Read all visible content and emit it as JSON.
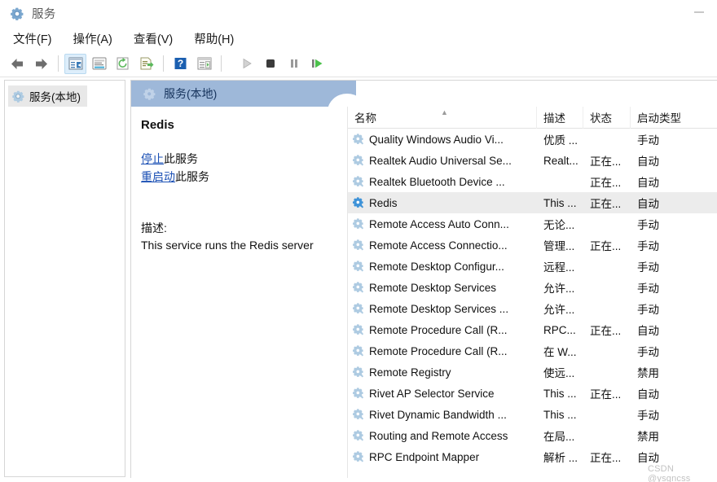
{
  "window": {
    "title": "服务",
    "title_icon": "services-gear-icon",
    "minimize_label": "最小化"
  },
  "menubar": {
    "items": [
      {
        "label": "文件(F)",
        "name": "menu-file"
      },
      {
        "label": "操作(A)",
        "name": "menu-action"
      },
      {
        "label": "查看(V)",
        "name": "menu-view"
      },
      {
        "label": "帮助(H)",
        "name": "menu-help"
      }
    ]
  },
  "toolbar": {
    "buttons": [
      {
        "name": "back-button",
        "icon": "arrow-left-icon",
        "enabled": true
      },
      {
        "name": "forward-button",
        "icon": "arrow-right-icon",
        "enabled": true
      },
      {
        "name": "show-hide-tree-button",
        "icon": "show-console-tree-icon",
        "enabled": true,
        "active": true
      },
      {
        "name": "properties-button",
        "icon": "properties-icon",
        "enabled": true
      },
      {
        "name": "refresh-button",
        "icon": "refresh-icon",
        "enabled": true
      },
      {
        "name": "export-list-button",
        "icon": "export-list-icon",
        "enabled": true
      },
      {
        "name": "help-button",
        "icon": "help-question-icon",
        "enabled": true
      },
      {
        "name": "show-action-pane-button",
        "icon": "action-pane-icon",
        "enabled": true
      },
      {
        "name": "start-service-button",
        "icon": "play-icon",
        "enabled": false
      },
      {
        "name": "stop-service-button",
        "icon": "stop-icon",
        "enabled": false
      },
      {
        "name": "pause-service-button",
        "icon": "pause-icon",
        "enabled": false
      },
      {
        "name": "restart-service-button",
        "icon": "restart-icon",
        "enabled": true
      }
    ]
  },
  "tree": {
    "root_label": "服务(本地)",
    "root_icon": "services-gear-icon"
  },
  "banner": {
    "label": "服务(本地)",
    "icon": "services-gear-icon",
    "color": "#9eb8d9"
  },
  "details": {
    "service_name": "Redis",
    "stop_link": "停止",
    "stop_suffix": "此服务",
    "restart_link": "重启动",
    "restart_suffix": "此服务",
    "description_label": "描述:",
    "description_text": "This service runs the Redis server",
    "link_color": "#1a4fb4"
  },
  "list": {
    "columns": [
      {
        "key": "name",
        "label": "名称",
        "sorted": "asc"
      },
      {
        "key": "desc",
        "label": "描述"
      },
      {
        "key": "state",
        "label": "状态"
      },
      {
        "key": "start",
        "label": "启动类型"
      }
    ],
    "rows": [
      {
        "name": "Quality Windows Audio Vi...",
        "desc": "优质 ...",
        "state": "",
        "start": "手动",
        "selected": false
      },
      {
        "name": "Realtek Audio Universal Se...",
        "desc": "Realt...",
        "state": "正在...",
        "start": "自动",
        "selected": false
      },
      {
        "name": "Realtek Bluetooth Device ...",
        "desc": "",
        "state": "正在...",
        "start": "自动",
        "selected": false
      },
      {
        "name": "Redis",
        "desc": "This ...",
        "state": "正在...",
        "start": "自动",
        "selected": true
      },
      {
        "name": "Remote Access Auto Conn...",
        "desc": "无论...",
        "state": "",
        "start": "手动",
        "selected": false
      },
      {
        "name": "Remote Access Connectio...",
        "desc": "管理...",
        "state": "正在...",
        "start": "手动",
        "selected": false
      },
      {
        "name": "Remote Desktop Configur...",
        "desc": "远程...",
        "state": "",
        "start": "手动",
        "selected": false
      },
      {
        "name": "Remote Desktop Services",
        "desc": "允许...",
        "state": "",
        "start": "手动",
        "selected": false
      },
      {
        "name": "Remote Desktop Services ...",
        "desc": "允许...",
        "state": "",
        "start": "手动",
        "selected": false
      },
      {
        "name": "Remote Procedure Call (R...",
        "desc": "RPC...",
        "state": "正在...",
        "start": "自动",
        "selected": false
      },
      {
        "name": "Remote Procedure Call (R...",
        "desc": "在 W...",
        "state": "",
        "start": "手动",
        "selected": false
      },
      {
        "name": "Remote Registry",
        "desc": "使远...",
        "state": "",
        "start": "禁用",
        "selected": false
      },
      {
        "name": "Rivet AP Selector Service",
        "desc": "This ...",
        "state": "正在...",
        "start": "自动",
        "selected": false
      },
      {
        "name": "Rivet Dynamic Bandwidth ...",
        "desc": "This ...",
        "state": "",
        "start": "手动",
        "selected": false
      },
      {
        "name": "Routing and Remote Access",
        "desc": "在局...",
        "state": "",
        "start": "禁用",
        "selected": false
      },
      {
        "name": "RPC Endpoint Mapper",
        "desc": "解析 ...",
        "state": "正在...",
        "start": "自动",
        "selected": false
      }
    ]
  },
  "watermark": {
    "text": "CSDN @ysgncss"
  }
}
